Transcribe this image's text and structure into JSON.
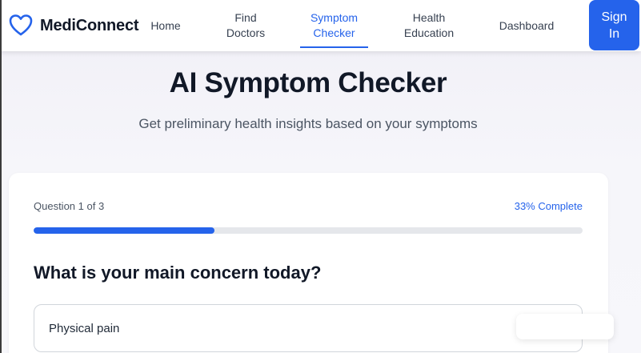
{
  "header": {
    "brand": "MediConnect",
    "logo_icon": "heart-icon",
    "accent_color": "#2563eb",
    "nav": {
      "home": "Home",
      "find_line1": "Find",
      "find_line2": "Doctors",
      "symptom_line1": "Symptom",
      "symptom_line2": "Checker",
      "health_line1": "Health",
      "health_line2": "Education",
      "dashboard": "Dashboard"
    },
    "active_nav": "Symptom Checker",
    "signin_line1": "Sign",
    "signin_line2": "In"
  },
  "hero": {
    "title": "AI Symptom Checker",
    "subtitle": "Get preliminary health insights based on your symptoms"
  },
  "quiz": {
    "counter": "Question 1 of 3",
    "percent_label": "33% Complete",
    "progress": 0.33,
    "question": "What is your main concern today?",
    "options": [
      {
        "label": "Physical pain"
      }
    ]
  }
}
